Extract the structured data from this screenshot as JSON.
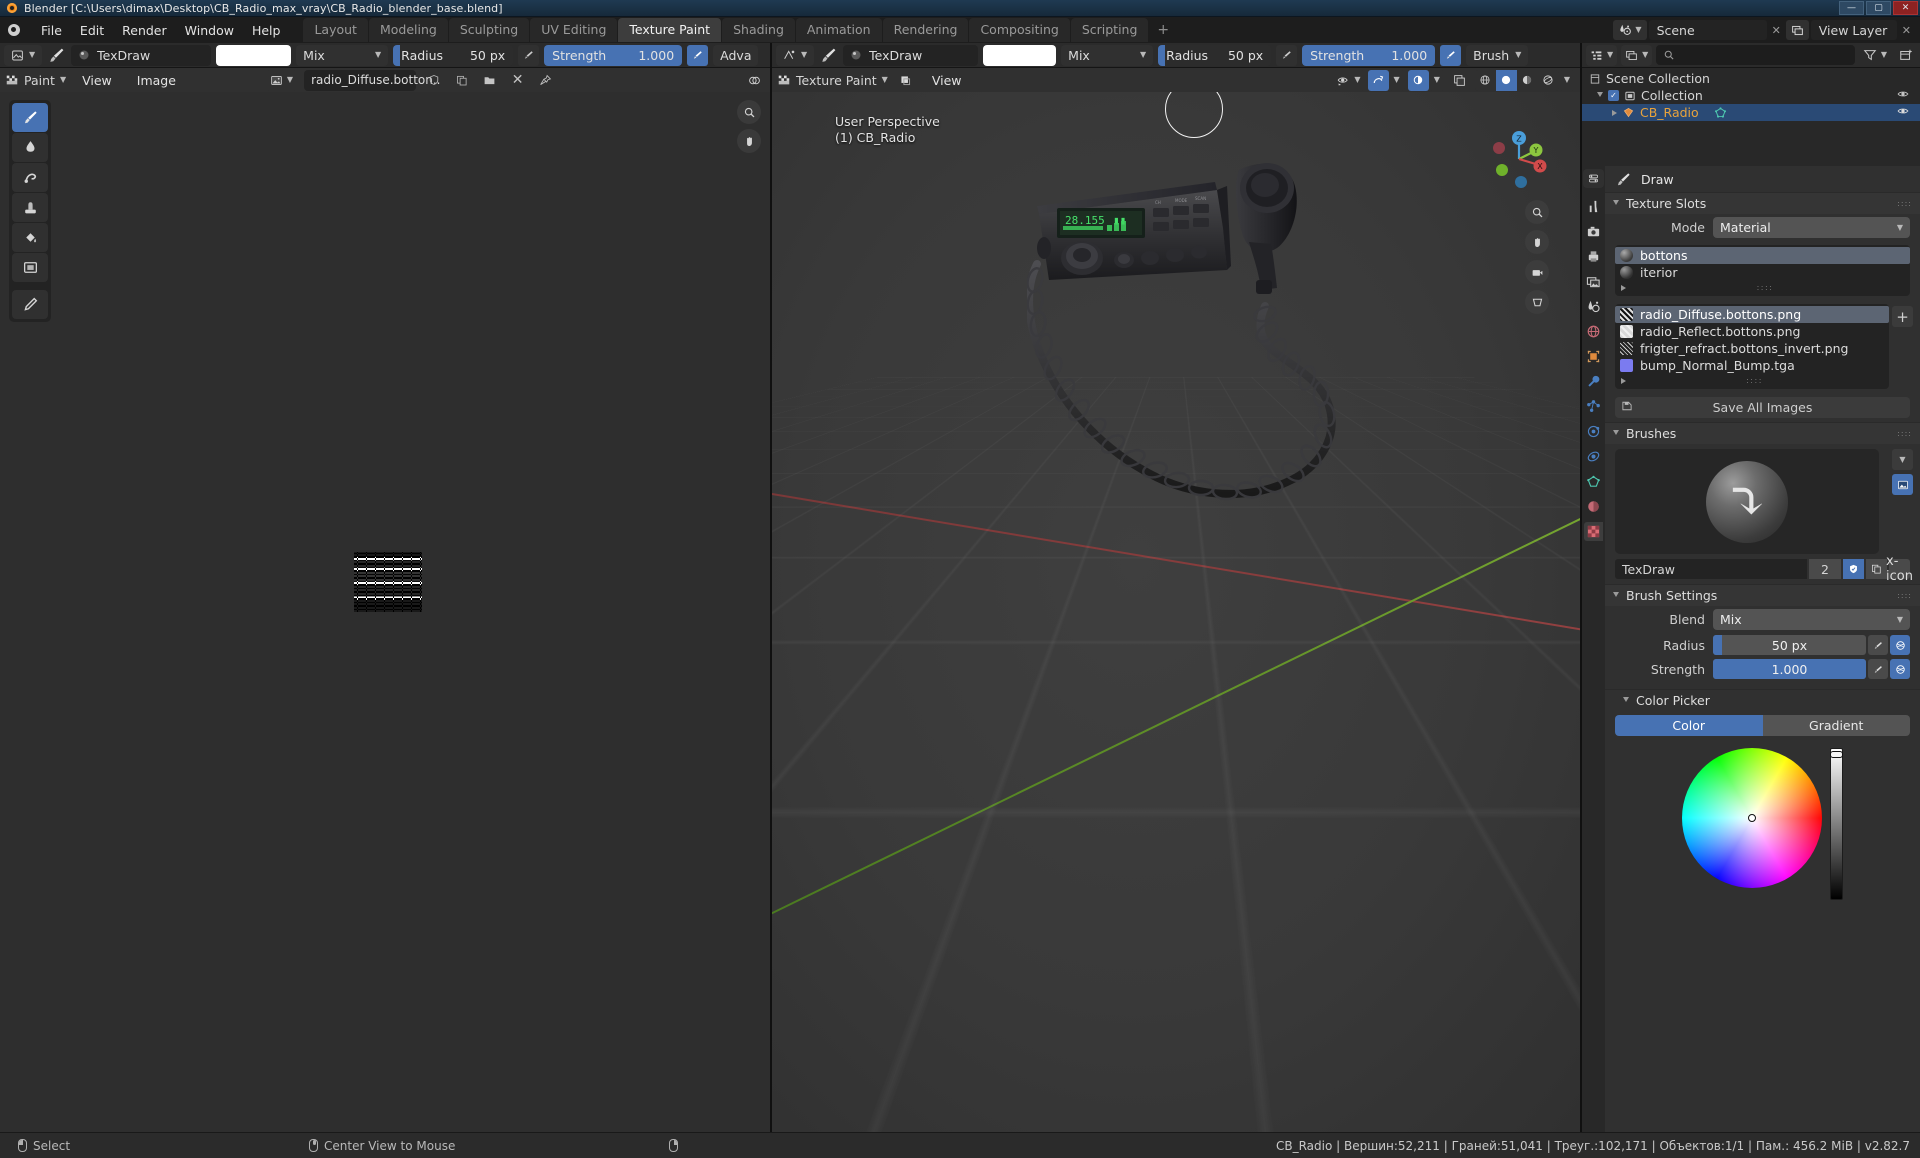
{
  "window": {
    "title": "Blender [C:\\Users\\dimax\\Desktop\\CB_Radio_max_vray\\CB_Radio_blender_base.blend]",
    "minimize": "—",
    "maximize": "▢",
    "close": "✕"
  },
  "topbar": {
    "menus": [
      "File",
      "Edit",
      "Render",
      "Window",
      "Help"
    ],
    "workspaces": [
      "Layout",
      "Modeling",
      "Sculpting",
      "UV Editing",
      "Texture Paint",
      "Shading",
      "Animation",
      "Rendering",
      "Compositing",
      "Scripting"
    ],
    "active_workspace": "Texture Paint",
    "add_workspace": "+",
    "scene_name": "Scene",
    "view_layer_name": "View Layer",
    "scene_remove": "✕",
    "viewlayer_remove": "✕"
  },
  "image_editor": {
    "header": {
      "editor_type": "image-editor-icon",
      "brush_icon": "brush-icon",
      "brush_name": "TexDraw",
      "color_swatch": "#ffffff",
      "blend_mode": "Mix",
      "radius_label": "Radius",
      "radius_value": "50 px",
      "strength_label": "Strength",
      "strength_value": "1.000",
      "advanced_label": "Adva"
    },
    "subheader": {
      "mode": "Paint",
      "menus": [
        "View",
        "Image"
      ],
      "image_name": "radio_Diffuse.botton..",
      "fake_user_icon": "shield-icon",
      "copy_icon": "copy-icon",
      "open_icon": "folder-icon",
      "unlink_icon": "x-icon",
      "pin_icon": "pin-icon",
      "overlay_icon": "overlay-icon"
    },
    "tools": [
      {
        "name": "tool-draw",
        "icon": "brush-icon",
        "active": true
      },
      {
        "name": "tool-soften",
        "icon": "droplet-icon",
        "active": false
      },
      {
        "name": "tool-smear",
        "icon": "smear-icon",
        "active": false
      },
      {
        "name": "tool-clone",
        "icon": "stamp-icon",
        "active": false
      },
      {
        "name": "tool-fill",
        "icon": "fill-icon",
        "active": false
      },
      {
        "name": "tool-mask",
        "icon": "mask-icon",
        "active": false
      },
      {
        "name": "tool-annotate",
        "icon": "pencil-icon",
        "active": false
      }
    ],
    "nav": [
      {
        "name": "zoom-icon",
        "glyph": "⌕"
      },
      {
        "name": "pan-hand-icon",
        "glyph": "✋"
      }
    ]
  },
  "viewport": {
    "header": {
      "editor_type": "3d-viewport-icon",
      "brush_icon": "brush-icon",
      "brush_name": "TexDraw",
      "color_swatch": "#ffffff",
      "blend_mode": "Mix",
      "radius_label": "Radius",
      "radius_value": "50 px",
      "strength_label": "Strength",
      "strength_value": "1.000",
      "brush_menu": "Brush"
    },
    "subheader": {
      "mode": "Texture Paint",
      "menus": [
        "View"
      ],
      "overlay_toggle": "overlay-icon",
      "xray_toggle": "xray-icon",
      "shading_modes": [
        "wireframe",
        "solid",
        "material",
        "rendered"
      ],
      "active_shading": "solid"
    },
    "overlay_text_line1": "User Perspective",
    "overlay_text_line2": "(1) CB_Radio",
    "gizmo_axes": [
      "Z",
      "Y",
      "X"
    ],
    "nav_buttons": [
      "zoom-icon",
      "pan-hand-icon",
      "camera-icon",
      "ortho-persp-icon"
    ]
  },
  "outliner": {
    "header": {
      "display_mode": "view-layer-icon",
      "filter_icon": "filter-icon",
      "new_collection_icon": "new-collection-icon",
      "search_placeholder": ""
    },
    "rows": [
      {
        "label": "Scene Collection",
        "icon": "scene-collection-icon",
        "indent": 0,
        "selected": false,
        "eye": false,
        "checkbox": false,
        "expand": "none"
      },
      {
        "label": "Collection",
        "icon": "collection-icon",
        "indent": 1,
        "selected": false,
        "eye": true,
        "checkbox": true,
        "expand": "down"
      },
      {
        "label": "CB_Radio",
        "icon": "mesh-object-icon",
        "indent": 2,
        "selected": true,
        "eye": true,
        "checkbox": false,
        "expand": "right"
      }
    ]
  },
  "properties": {
    "tabs": [
      {
        "name": "tool-tab",
        "icon": "tool-icon",
        "active": false
      },
      {
        "name": "render-tab",
        "icon": "camera-back-icon",
        "active": false
      },
      {
        "name": "output-tab",
        "icon": "printer-icon",
        "active": false
      },
      {
        "name": "viewlayer-tab",
        "icon": "images-icon",
        "active": false
      },
      {
        "name": "scene-tab",
        "icon": "cone-sphere-icon",
        "active": false
      },
      {
        "name": "world-tab",
        "icon": "world-icon",
        "active": false
      },
      {
        "name": "object-tab",
        "icon": "object-square-icon",
        "active": false
      },
      {
        "name": "modifier-tab",
        "icon": "wrench-icon",
        "active": false
      },
      {
        "name": "particles-tab",
        "icon": "particles-icon",
        "active": false
      },
      {
        "name": "physics-tab",
        "icon": "physics-icon",
        "active": false
      },
      {
        "name": "constraints-tab",
        "icon": "constraints-icon",
        "active": false
      },
      {
        "name": "data-tab",
        "icon": "mesh-data-icon",
        "active": false
      },
      {
        "name": "material-tab",
        "icon": "material-sphere-icon",
        "active": false
      },
      {
        "name": "texture-tab",
        "icon": "checker-icon",
        "active": true
      }
    ],
    "brush_header": "Draw",
    "texture_slots": {
      "title": "Texture Slots",
      "mode_label": "Mode",
      "mode_value": "Material",
      "materials": [
        {
          "label": "bottons",
          "selected": true
        },
        {
          "label": "iterior",
          "selected": false
        }
      ],
      "images": [
        {
          "label": "radio_Diffuse.bottons.png",
          "selected": true,
          "swatch": "#3a3a3a"
        },
        {
          "label": "radio_Reflect.bottons.png",
          "selected": false,
          "swatch": "#d6d6d6"
        },
        {
          "label": "frigter_refract.bottons_invert.png",
          "selected": false,
          "swatch": "#9b9b9b"
        },
        {
          "label": "bump_Normal_Bump.tga",
          "selected": false,
          "swatch": "#7b7bf0"
        }
      ],
      "add_button": "+",
      "save_all_images": "Save All Images"
    },
    "brushes": {
      "title": "Brushes",
      "brush_name": "TexDraw",
      "users_count": "2",
      "fake_user_icon": "shield-icon",
      "duplicate_icon": "copy-icon",
      "unlink_icon": "x-icon",
      "preview_dropdown_icon": "chevron-down-icon",
      "preview_image_icon": "image-icon"
    },
    "brush_settings": {
      "title": "Brush Settings",
      "blend_label": "Blend",
      "blend_value": "Mix",
      "radius_label": "Radius",
      "radius_value": "50 px",
      "radius_fill_pct": 6,
      "strength_label": "Strength",
      "strength_value": "1.000",
      "strength_fill_pct": 100,
      "pressure_icon": "pressure-icon",
      "unified_icon": "unified-icon"
    },
    "color_picker": {
      "title": "Color Picker",
      "tabs": [
        "Color",
        "Gradient"
      ],
      "active_tab": "Color"
    }
  },
  "statusbar": {
    "left": [
      {
        "icon": "mouse-left-icon",
        "label": "Select"
      },
      {
        "icon": "mouse-middle-icon",
        "label": "Center View to Mouse"
      },
      {
        "icon": "mouse-right-icon",
        "label": ""
      }
    ],
    "right": "CB_Radio | Вершин:52,211 | Граней:51,041 | Треуг.:102,171 | Объектов:1/1 | Пам.: 456.2 MiB | v2.82.7"
  },
  "colors": {
    "accent": "#4772b3",
    "selected_row": "#2a4a75",
    "panel_bg": "#303030",
    "header_bg": "#2b2b2b",
    "field_bg": "#545454"
  }
}
